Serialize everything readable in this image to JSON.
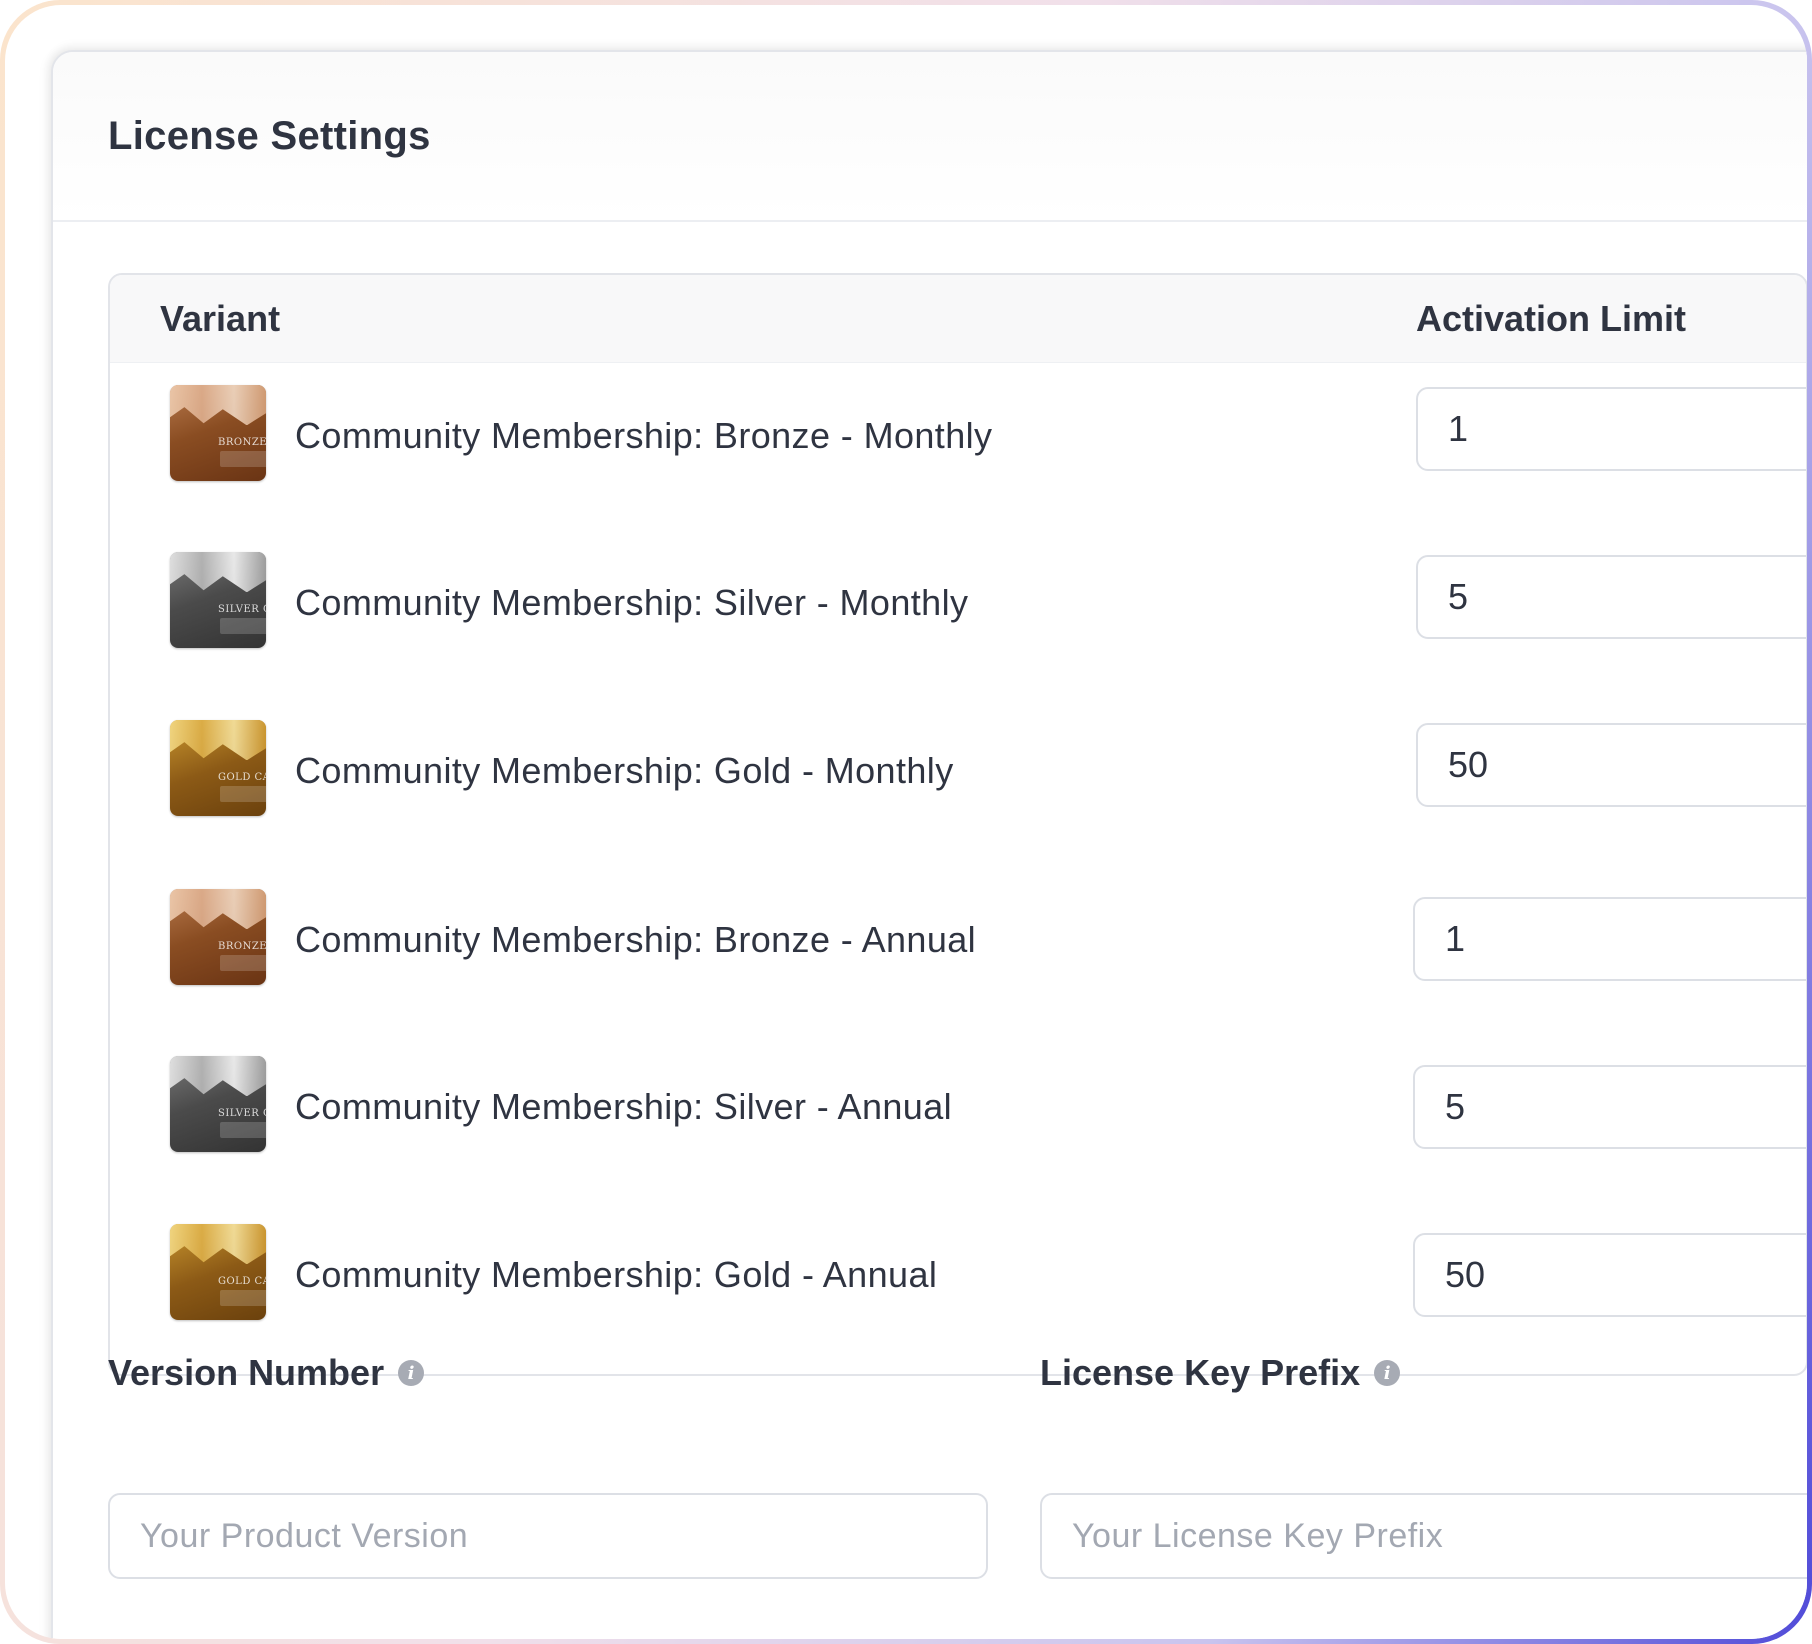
{
  "card": {
    "title": "License Settings"
  },
  "table": {
    "headers": {
      "variant": "Variant",
      "activation_limit": "Activation Limit"
    },
    "rows": [
      {
        "name": "Community Membership: Bronze - Monthly",
        "limit": "1",
        "thumb": "bronze-card-image",
        "thumb_text": "BRONZE CARD"
      },
      {
        "name": "Community Membership: Silver - Monthly",
        "limit": "5",
        "thumb": "silver-card-image",
        "thumb_text": "SILVER CARD"
      },
      {
        "name": "Community Membership: Gold - Monthly",
        "limit": "50",
        "thumb": "gold-card-image",
        "thumb_text": "GOLD CARD"
      },
      {
        "name": "Community Membership: Bronze - Annual",
        "limit": "1",
        "thumb": "bronze-card-image",
        "thumb_text": "BRONZE CARD"
      },
      {
        "name": "Community Membership: Silver - Annual",
        "limit": "5",
        "thumb": "silver-card-image",
        "thumb_text": "SILVER CARD"
      },
      {
        "name": "Community Membership: Gold - Annual",
        "limit": "50",
        "thumb": "gold-card-image",
        "thumb_text": "GOLD CARD"
      }
    ]
  },
  "fields": {
    "version_number": {
      "label": "Version Number",
      "placeholder": "Your Product Version",
      "value": ""
    },
    "license_key_prefix": {
      "label": "License Key Prefix",
      "placeholder": "Your License Key Prefix",
      "value": ""
    }
  },
  "icons": {
    "info": "info-icon"
  },
  "colors": {
    "frame_gradient_start": "#fbe4cc",
    "frame_gradient_end": "#4f4ad8",
    "text": "#2f3441",
    "placeholder": "#a3a8b2",
    "border": "#dcdfe5"
  }
}
